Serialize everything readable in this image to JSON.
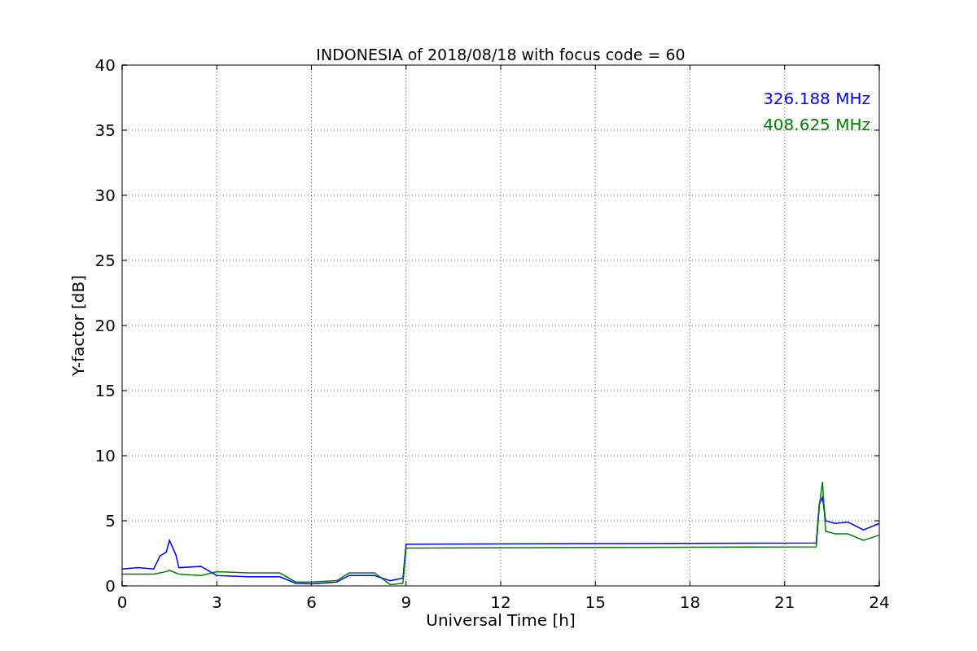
{
  "figure": {
    "chart_data": {
      "type": "line",
      "title": "INDONESIA of 2018/08/18 with focus code = 60",
      "xlabel": "Universal Time [h]",
      "ylabel": "Y-factor [dB]",
      "x": [
        0,
        0.5,
        1,
        1.2,
        1.4,
        1.5,
        1.7,
        1.8,
        2.5,
        3,
        4,
        5,
        5.5,
        6,
        6.8,
        7.2,
        8,
        8.5,
        8.9,
        9,
        15,
        22,
        22.1,
        22.2,
        22.3,
        22.6,
        23,
        23.5,
        24
      ],
      "series": [
        {
          "name": "326.188 MHz",
          "color": "#0000ff",
          "values": [
            1.3,
            1.4,
            1.3,
            2.3,
            2.6,
            3.5,
            2.4,
            1.4,
            1.5,
            0.8,
            0.7,
            0.7,
            0.2,
            0.15,
            0.3,
            0.8,
            0.8,
            0.4,
            0.6,
            3.2,
            3.25,
            3.3,
            6.3,
            6.8,
            5.0,
            4.8,
            4.9,
            4.3,
            4.8
          ]
        },
        {
          "name": "408.625 MHz",
          "color": "#008000",
          "values": [
            0.9,
            0.9,
            0.9,
            1.0,
            1.1,
            1.2,
            1.0,
            0.9,
            0.8,
            1.1,
            1.0,
            1.0,
            0.3,
            0.3,
            0.4,
            1.0,
            1.0,
            0.1,
            0.2,
            2.9,
            2.95,
            3.0,
            6.2,
            8.0,
            4.2,
            4.0,
            4.0,
            3.5,
            3.9
          ]
        }
      ],
      "xlim": [
        0,
        24
      ],
      "ylim": [
        0,
        40
      ],
      "xticks": [
        0,
        3,
        6,
        9,
        12,
        15,
        18,
        21,
        24
      ],
      "yticks": [
        0,
        5,
        10,
        15,
        20,
        25,
        30,
        35,
        40
      ],
      "grid": true
    }
  }
}
